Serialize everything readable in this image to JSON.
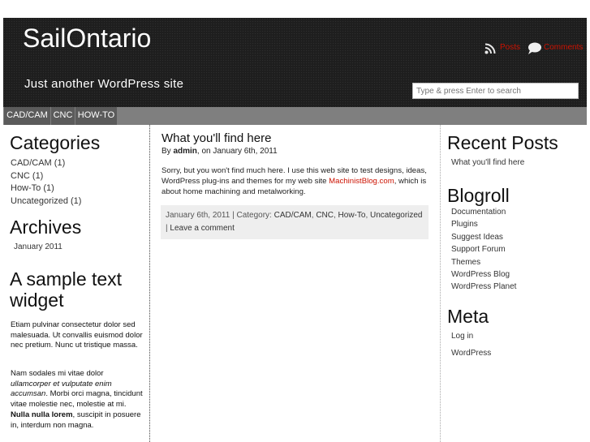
{
  "header": {
    "site_title": "SailOntario",
    "site_description": "Just another WordPress site",
    "feeds": [
      {
        "label": "Posts",
        "icon": "rss-icon"
      },
      {
        "label": "Comments",
        "icon": "speech-bubble-icon"
      }
    ],
    "search": {
      "placeholder": "Type & press Enter to search"
    }
  },
  "nav": [
    "CAD/CAM",
    "CNC",
    "HOW-TO"
  ],
  "left_sidebar": {
    "categories_title": "Categories",
    "categories": [
      {
        "name": "CAD/CAM",
        "count": "(1)"
      },
      {
        "name": "CNC",
        "count": "(1)"
      },
      {
        "name": "How-To",
        "count": "(1)"
      },
      {
        "name": "Uncategorized",
        "count": "(1)"
      }
    ],
    "archives_title": "Archives",
    "archives": [
      "January 2011"
    ],
    "text_widget_title_line1": "A sample text",
    "text_widget_title_line2": "widget",
    "text_p1": {
      "a": "Etiam pulvinar consectetur dolor sed malesuada. Ut convallis euismod dolor nec ",
      "b": "pretium",
      "c": ". Nunc ut tristique massa."
    },
    "text_p2": {
      "a": "Nam sodales mi vitae dolor ",
      "b": "ullamcorper et vulputate enim accumsan",
      "c": ". Morbi orci magna, tincidunt vitae molestie nec, molestie at mi. ",
      "d": "Nulla nulla lorem",
      "e": ", suscipit in posuere in, interdum non magna."
    }
  },
  "post": {
    "title": "What you'll find here",
    "by": "By ",
    "author": "admin",
    "date_text": ", on January 6th, 2011",
    "body_text": "Sorry, but you won't find much here.  I use this web site to test designs, ideas, WordPress plug-ins and themes for my web site ",
    "body_link": "MachinistBlog.com",
    "body_text2": ", which is about home machining and metalworking.",
    "meta": {
      "date": "January 6th, 2011",
      "sep1": " | Category: ",
      "categories": [
        "CAD/CAM",
        "CNC",
        "How-To",
        "Uncategorized"
      ],
      "sep2": "| ",
      "comment": "Leave a comment"
    }
  },
  "right_sidebar": {
    "recent_title": "Recent Posts",
    "recent": [
      "What you'll find here"
    ],
    "blogroll_title": "Blogroll",
    "blogroll": [
      "Documentation",
      "Plugins",
      "Suggest Ideas",
      "Support Forum",
      "Themes",
      "WordPress Blog",
      "WordPress Planet"
    ],
    "meta_title": "Meta",
    "meta": [
      "Log in",
      "WordPress"
    ]
  },
  "colors": {
    "header_bg": "#1e1e1e",
    "accent_red": "#cc1100",
    "nav_bar": "#7f7f7f",
    "nav_item": "#5b5b5b",
    "meta_box": "#eeeeee"
  }
}
